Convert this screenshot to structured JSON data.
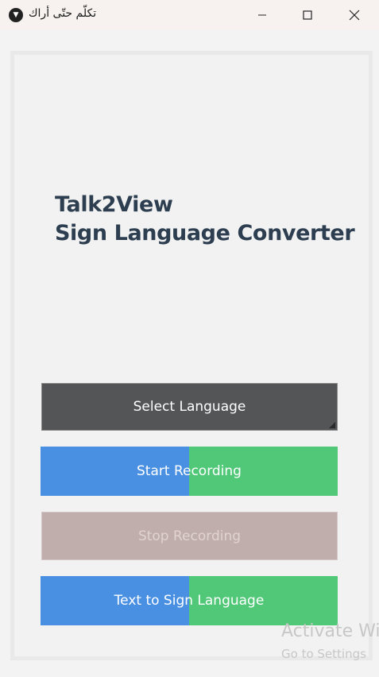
{
  "window": {
    "title": "تكلّم حتّى أراك",
    "app_icon": "app-logo-icon",
    "controls": {
      "minimize": "minimize-icon",
      "maximize": "maximize-icon",
      "close": "close-icon"
    }
  },
  "header": {
    "line1": "Talk2View",
    "line2": "Sign Language Converter"
  },
  "buttons": {
    "select_language": "Select Language",
    "start_recording": "Start Recording",
    "stop_recording": "Stop Recording",
    "text_to_sign": "Text to Sign Language"
  },
  "watermark": {
    "line1": "Activate Wi",
    "line2": "Go to Settings"
  },
  "colors": {
    "heading": "#2c3e50",
    "select_button": "#545556",
    "split_left": "#4a90e2",
    "split_right": "#50c878",
    "stop_disabled": "#c0aeac"
  }
}
